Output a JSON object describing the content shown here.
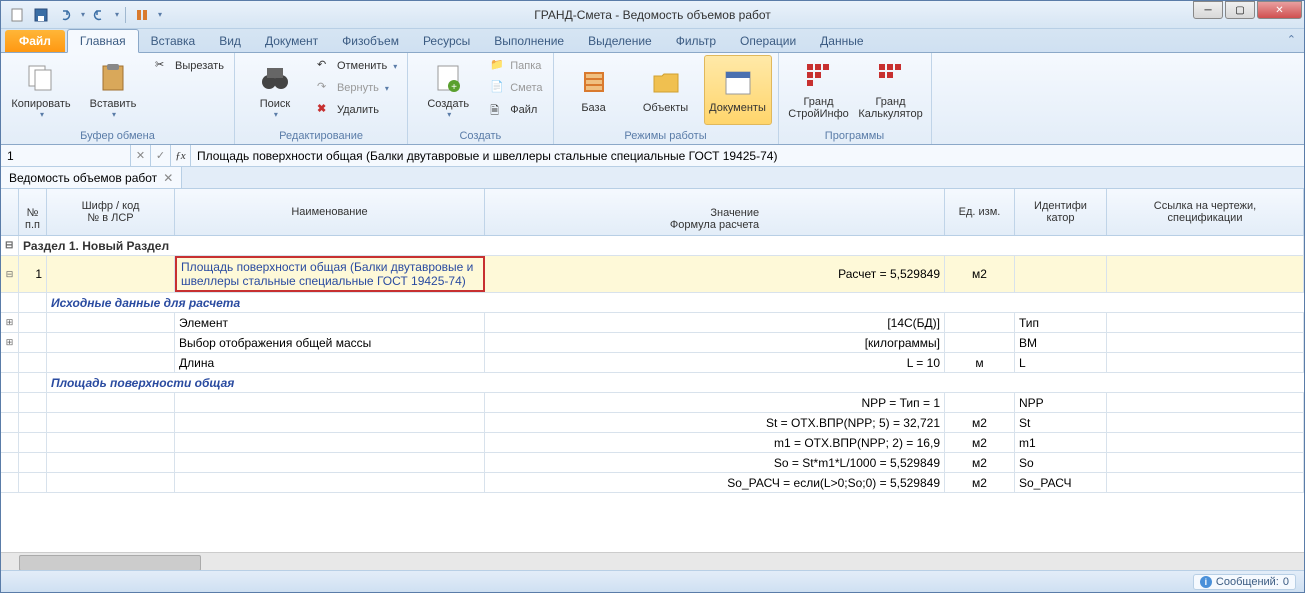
{
  "window": {
    "title": "ГРАНД-Смета - Ведомость объемов работ"
  },
  "ribbon": {
    "file_tab": "Файл",
    "tabs": [
      "Главная",
      "Вставка",
      "Вид",
      "Документ",
      "Физобъем",
      "Ресурсы",
      "Выполнение",
      "Выделение",
      "Фильтр",
      "Операции",
      "Данные"
    ],
    "active_tab": 0,
    "groups": {
      "clipboard": {
        "label": "Буфер обмена",
        "copy": "Копировать",
        "paste": "Вставить",
        "cut": "Вырезать"
      },
      "editing": {
        "label": "Редактирование",
        "search": "Поиск",
        "undo": "Отменить",
        "redo": "Вернуть",
        "delete": "Удалить"
      },
      "create": {
        "label": "Создать",
        "create": "Создать",
        "folder": "Папка",
        "estimate": "Смета",
        "file": "Файл"
      },
      "modes": {
        "label": "Режимы работы",
        "base": "База",
        "objects": "Объекты",
        "documents": "Документы"
      },
      "programs": {
        "label": "Программы",
        "stroyinfo": "Гранд СтройИнфо",
        "calc": "Гранд Калькулятор"
      }
    }
  },
  "formula_bar": {
    "cell_ref": "1",
    "value": "Площадь поверхности общая (Балки двутавровые и швеллеры стальные специальные ГОСТ 19425-74)"
  },
  "doc_tab": {
    "label": "Ведомость объемов работ"
  },
  "grid": {
    "headers": {
      "num": "№\nп.п",
      "code": "Шифр / код\n№ в ЛСР",
      "name": "Наименование",
      "value": "Значение\nФормула расчета",
      "unit": "Ед. изм.",
      "id": "Идентифи\nкатор",
      "ref": "Ссылка на чертежи,\nспецификации"
    },
    "section": "Раздел 1. Новый Раздел",
    "row1": {
      "num": "1",
      "name": "Площадь поверхности общая (Балки двутавровые и швеллеры стальные специальные ГОСТ 19425-74)",
      "value": "Расчет = 5,529849",
      "unit": "м2"
    },
    "sub1_title": "Исходные данные для расчета",
    "sub1_rows": [
      {
        "name": "Элемент",
        "value": "[14С(БД)]",
        "unit": "",
        "id": "Тип"
      },
      {
        "name": "Выбор отображения общей массы",
        "value": "[килограммы]",
        "unit": "",
        "id": "ВМ"
      },
      {
        "name": "Длина",
        "value": "L = 10",
        "unit": "м",
        "id": "L"
      }
    ],
    "sub2_title": "Площадь поверхности общая",
    "sub2_rows": [
      {
        "name": "",
        "value": "NPP = Тип = 1",
        "unit": "",
        "id": "NPP"
      },
      {
        "name": "",
        "value": "St = ОТХ.ВПР(NPP; 5) = 32,721",
        "unit": "м2",
        "id": "St"
      },
      {
        "name": "",
        "value": "m1 = ОТХ.ВПР(NPP; 2) = 16,9",
        "unit": "м2",
        "id": "m1"
      },
      {
        "name": "",
        "value": "So = St*m1*L/1000 = 5,529849",
        "unit": "м2",
        "id": "So"
      },
      {
        "name": "",
        "value": "So_РАСЧ = если(L>0;So;0) = 5,529849",
        "unit": "м2",
        "id": "So_РАСЧ"
      }
    ]
  },
  "status": {
    "messages_label": "Сообщений:",
    "messages_count": "0"
  }
}
